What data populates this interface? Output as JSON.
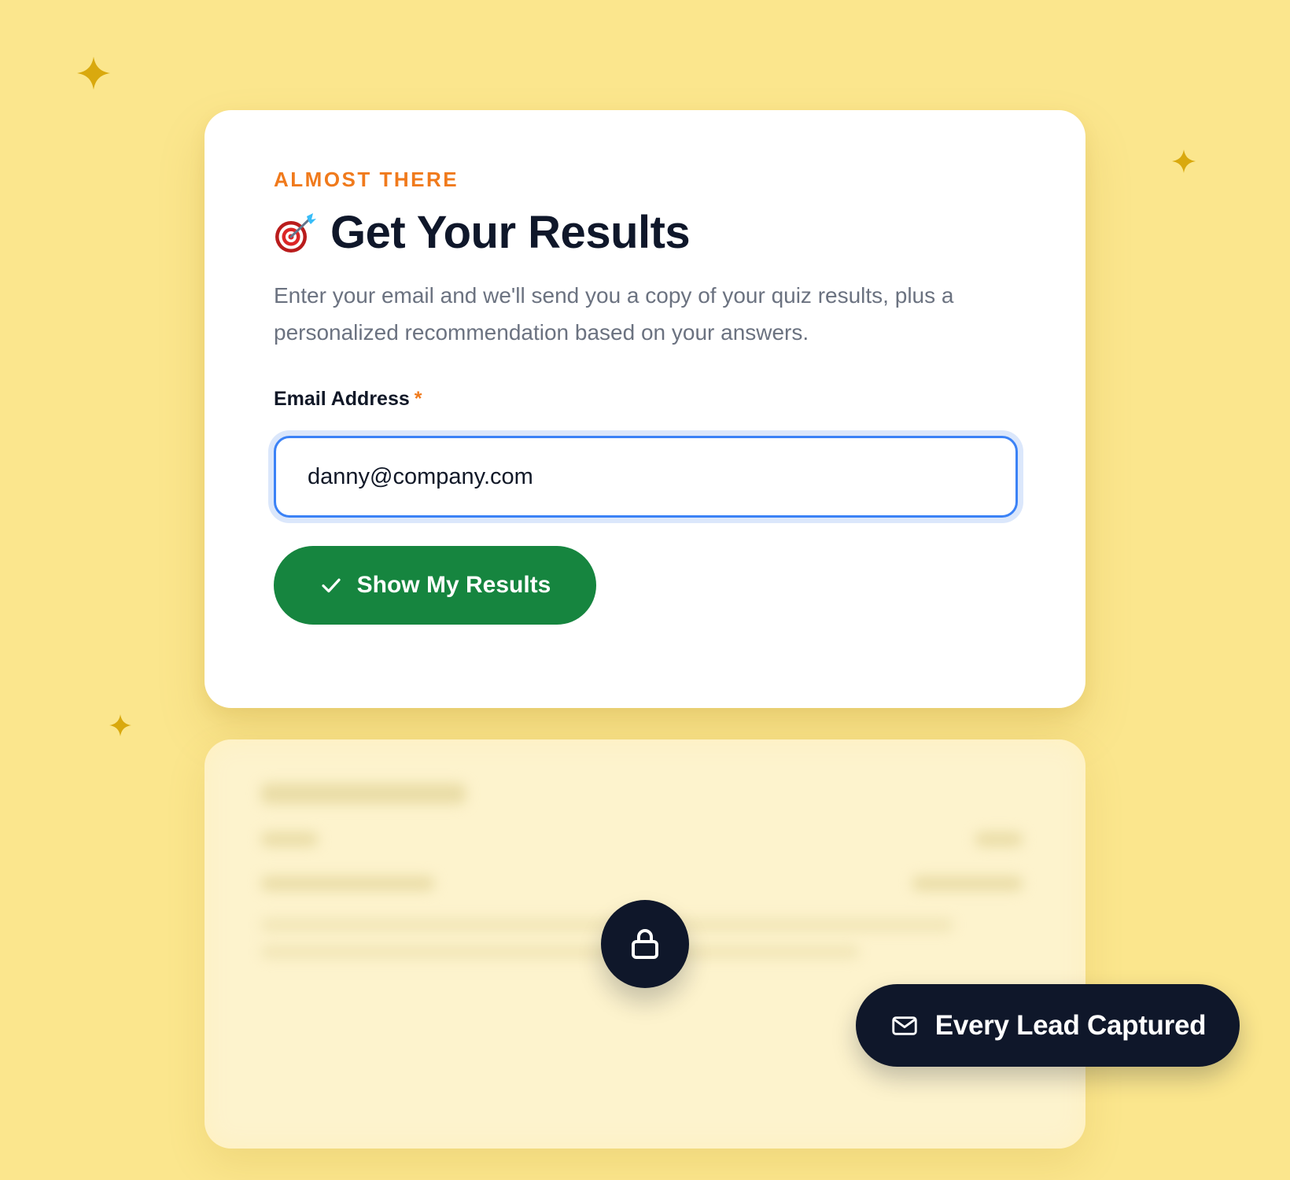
{
  "colors": {
    "background": "#fbe68d",
    "card": "#ffffff",
    "accent_orange": "#f07a1c",
    "heading": "#0f172a",
    "body_text": "#6b7280",
    "input_focus": "#3b82f6",
    "button_green": "#16853f",
    "dark_pill": "#0f172a",
    "sparkle": "#d9a90e"
  },
  "lead_form": {
    "eyebrow": "ALMOST THERE",
    "title_icon": "target-dart-icon",
    "title": "Get Your Results",
    "description": "Enter your email and we'll send you a copy of your quiz results, plus a personalized recommendation based on your answers.",
    "email_label": "Email Address",
    "required_marker": "*",
    "email_value": "danny@company.com",
    "submit_icon": "check-icon",
    "submit_label": "Show My Results"
  },
  "locked_results": {
    "icon": "lock-icon"
  },
  "badge": {
    "icon": "mail-icon",
    "label": "Every Lead Captured"
  }
}
